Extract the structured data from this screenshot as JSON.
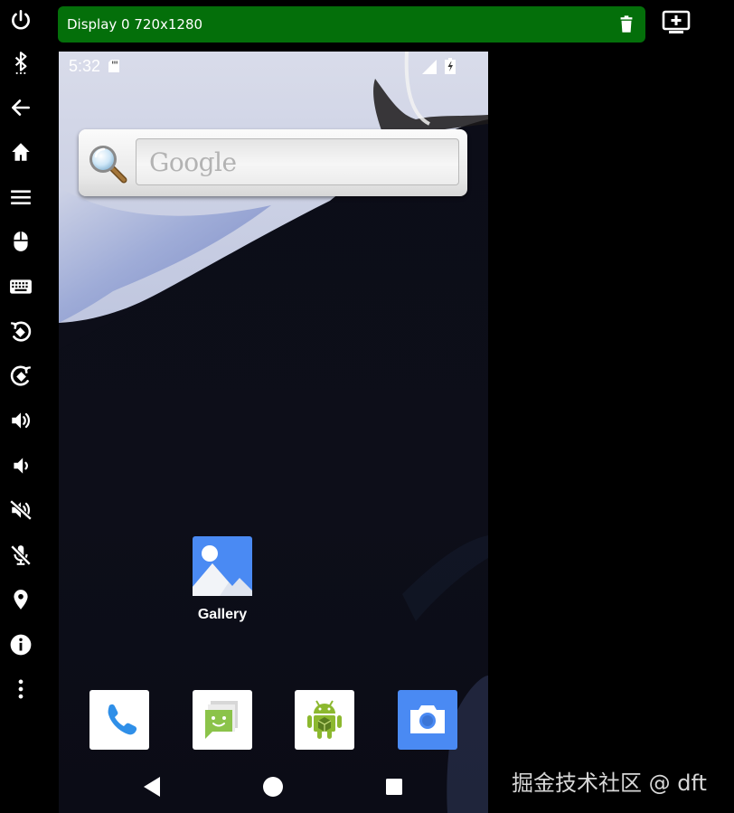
{
  "toolbar": {
    "items": [
      {
        "icon": "power-icon"
      },
      {
        "icon": "bluetooth-icon"
      },
      {
        "icon": "back-arrow-icon"
      },
      {
        "icon": "home-icon"
      },
      {
        "icon": "menu-icon"
      },
      {
        "icon": "mouse-icon"
      },
      {
        "icon": "keyboard-icon"
      },
      {
        "icon": "rotate-left-icon"
      },
      {
        "icon": "rotate-right-icon"
      },
      {
        "icon": "volume-up-icon"
      },
      {
        "icon": "volume-down-icon"
      },
      {
        "icon": "volume-mute-icon"
      },
      {
        "icon": "microphone-off-icon"
      },
      {
        "icon": "location-icon"
      },
      {
        "icon": "info-icon"
      },
      {
        "icon": "more-vertical-icon"
      }
    ]
  },
  "display": {
    "title": "Display 0 720x1280",
    "bar_color": "#046f0a"
  },
  "phone": {
    "status_bar": {
      "time": "5:32"
    },
    "search_widget": {
      "placeholder": "Google"
    },
    "apps": {
      "gallery": {
        "label": "Gallery",
        "icon": "gallery-icon"
      }
    },
    "dock": [
      {
        "icon": "phone-app-icon"
      },
      {
        "icon": "messaging-app-icon"
      },
      {
        "icon": "android-app-icon"
      },
      {
        "icon": "camera-app-icon"
      }
    ],
    "nav": [
      "nav-back-icon",
      "nav-home-icon",
      "nav-recents-icon"
    ]
  },
  "watermark": "掘金技术社区 @ dft"
}
